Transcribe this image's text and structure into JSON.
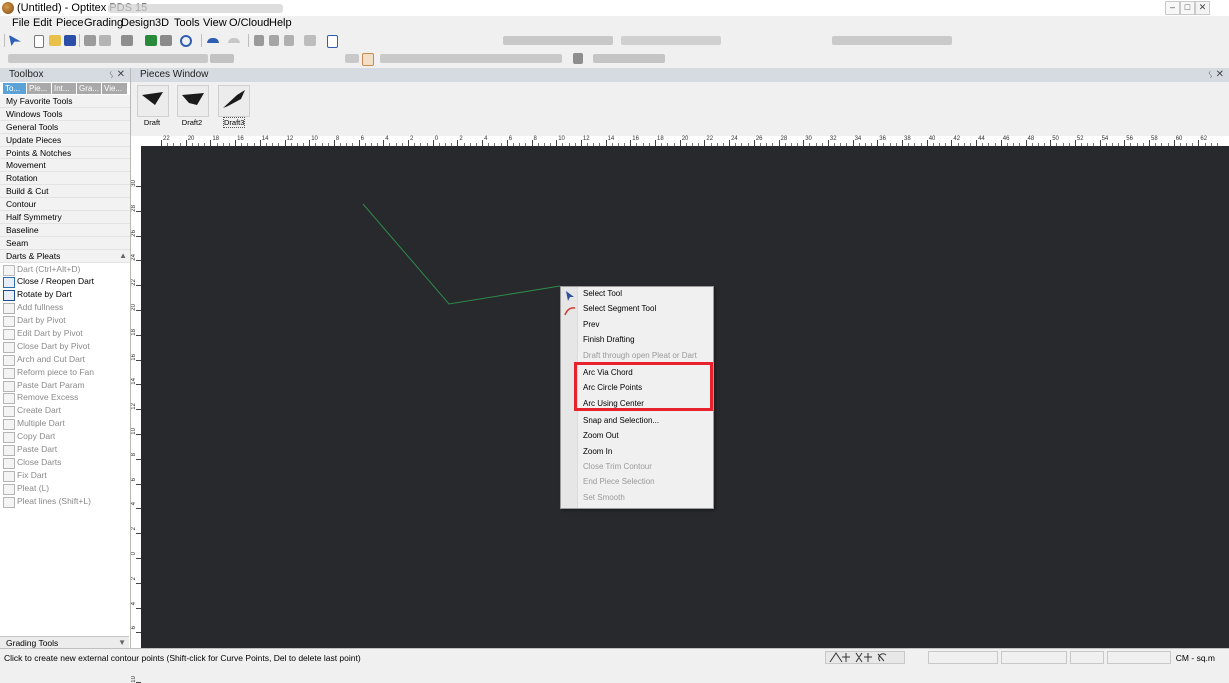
{
  "window": {
    "title": "(Untitled) - Optitex PDS 15",
    "controls": [
      "minimize-icon",
      "maximize-icon",
      "close-icon"
    ]
  },
  "menu": [
    "File",
    "Edit",
    "Piece",
    "Grading",
    "Design",
    "3D",
    "Tools",
    "View",
    "O/Cloud",
    "Help"
  ],
  "toolbox": {
    "title": "Toolbox",
    "tabs": [
      "To...",
      "Pie...",
      "Int...",
      "Gra...",
      "Vie..."
    ],
    "sections": [
      "My Favorite Tools",
      "Windows Tools",
      "General Tools",
      "Update Pieces",
      "Points & Notches",
      "Movement",
      "Rotation",
      "Build & Cut",
      "Contour",
      "Half Symmetry",
      "Baseline",
      "Seam",
      "Darts & Pleats"
    ],
    "tools": [
      {
        "label": "Dart (Ctrl+Alt+D)",
        "enabled": false
      },
      {
        "label": "Close / Reopen Dart",
        "enabled": true
      },
      {
        "label": "Rotate by Dart",
        "enabled": true
      },
      {
        "label": "Add fullness",
        "enabled": false
      },
      {
        "label": "Dart by Pivot",
        "enabled": false
      },
      {
        "label": "Edit Dart by Pivot",
        "enabled": false
      },
      {
        "label": "Close Dart by Pivot",
        "enabled": false
      },
      {
        "label": "Arch and Cut Dart",
        "enabled": false
      },
      {
        "label": "Reform piece to Fan",
        "enabled": false
      },
      {
        "label": "Paste Dart Param",
        "enabled": false
      },
      {
        "label": "Remove Excess",
        "enabled": false
      },
      {
        "label": "Create Dart",
        "enabled": false
      },
      {
        "label": "Multiple Dart",
        "enabled": false
      },
      {
        "label": "Copy Dart",
        "enabled": false
      },
      {
        "label": "Paste Dart",
        "enabled": false
      },
      {
        "label": "Close Darts",
        "enabled": false
      },
      {
        "label": "Fix Dart",
        "enabled": false
      },
      {
        "label": "Pleat (L)",
        "enabled": false
      },
      {
        "label": "Pleat lines (Shift+L)",
        "enabled": false
      }
    ],
    "bottom_section": "Grading Tools"
  },
  "pieces_window": {
    "title": "Pieces Window",
    "pieces": [
      "Draft",
      "Draft2",
      "Draft3"
    ]
  },
  "ruler": {
    "h_labels": [
      "22",
      "20",
      "18",
      "16",
      "14",
      "12",
      "10",
      "8",
      "6",
      "4",
      "2",
      "0",
      "2",
      "4",
      "6",
      "8",
      "10",
      "12",
      "14",
      "16",
      "18",
      "20",
      "22",
      "24",
      "26",
      "28",
      "30",
      "32",
      "34",
      "36",
      "38",
      "40",
      "42",
      "44",
      "46",
      "48",
      "50",
      "52",
      "54",
      "56",
      "58",
      "60",
      "62"
    ],
    "v_labels": [
      "30",
      "28",
      "26",
      "24",
      "22",
      "20",
      "18",
      "16",
      "14",
      "12",
      "10",
      "8",
      "6",
      "4",
      "2",
      "0",
      "2",
      "4",
      "6",
      "8",
      "10"
    ]
  },
  "context_menu": {
    "items": [
      {
        "label": "Select Tool",
        "enabled": true,
        "icon": "arrow-cursor-icon"
      },
      {
        "label": "Select Segment Tool",
        "enabled": true,
        "icon": "segment-tool-icon"
      },
      {
        "label": "Prev",
        "enabled": true
      },
      {
        "label": "Finish Drafting",
        "enabled": true
      },
      {
        "label": "Draft through open Pleat or Dart",
        "enabled": false
      },
      {
        "label": "Arc Via Chord",
        "enabled": true
      },
      {
        "label": "Arc Circle Points",
        "enabled": true
      },
      {
        "label": "Arc Using Center",
        "enabled": true
      },
      {
        "label": "Snap and Selection...",
        "enabled": true
      },
      {
        "label": "Zoom Out",
        "enabled": true
      },
      {
        "label": "Zoom In",
        "enabled": true
      },
      {
        "label": "Close Trim Contour",
        "enabled": false
      },
      {
        "label": "End Piece Selection",
        "enabled": false
      },
      {
        "label": "Set Smooth",
        "enabled": false
      }
    ]
  },
  "status": {
    "message": "Click to create new external contour points (Shift-click for Curve Points, Del to delete last point)",
    "units": "CM - sq.m"
  },
  "colors": {
    "canvas": "#28292c",
    "draft_line": "#2e8a4a",
    "highlight": "#e8212c",
    "active_tab": "#5ba2d8"
  }
}
